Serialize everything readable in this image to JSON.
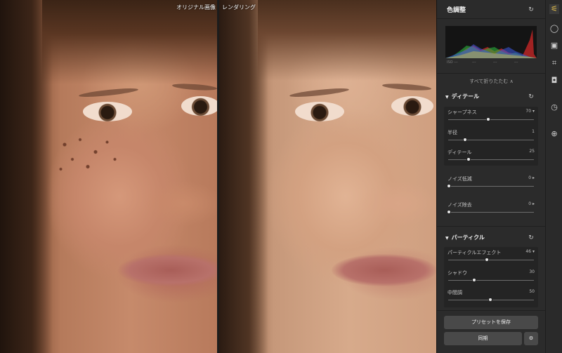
{
  "compare": {
    "left_label": "オリジナル画像",
    "right_label": "レンダリング"
  },
  "panel": {
    "title": "色調整",
    "exif": [
      "ISO ---",
      "---",
      "---",
      "---"
    ],
    "collapse_label": "すべて折りたたむ ∧",
    "sections": [
      {
        "title": "ディテール",
        "sliders": [
          {
            "label": "シャープネス",
            "value": "70",
            "pos": 0.5,
            "has_menu": true
          },
          {
            "label": "半径",
            "value": "1",
            "pos": 0.2,
            "has_menu": false
          },
          {
            "label": "ディテール",
            "value": "25",
            "pos": 0.27,
            "has_menu": false
          }
        ]
      },
      {
        "slider": {
          "label": "ノイズ低減",
          "value": "0",
          "pos": 0.0,
          "has_menu": true
        }
      },
      {
        "slider": {
          "label": "ノイズ除去",
          "value": "0",
          "pos": 0.0,
          "has_menu": true
        }
      },
      {
        "title": "パーティクル",
        "sliders": [
          {
            "label": "パーティクルエフェクト",
            "value": "46",
            "pos": 0.46,
            "has_menu": true
          },
          {
            "label": "シャドウ",
            "value": "30",
            "pos": 0.3,
            "has_menu": false
          },
          {
            "label": "中間調",
            "value": "50",
            "pos": 0.5,
            "has_menu": false
          }
        ]
      }
    ],
    "save_preset": "プリセットを保存",
    "sync": "同期"
  },
  "toolbar": {
    "tools": [
      {
        "name": "adjust-icon",
        "glyph": "⚟"
      },
      {
        "name": "bulb-icon",
        "glyph": "◯"
      },
      {
        "name": "image-icon",
        "glyph": "▣"
      },
      {
        "name": "crop-icon",
        "glyph": "⌗"
      },
      {
        "name": "camera-icon",
        "glyph": "◘"
      },
      {
        "name": "history-icon",
        "glyph": "◷"
      },
      {
        "name": "add-icon",
        "glyph": "⊕"
      }
    ]
  },
  "colors": {
    "accent": "#e8c24a",
    "panel_bg": "#2b2b2b"
  }
}
